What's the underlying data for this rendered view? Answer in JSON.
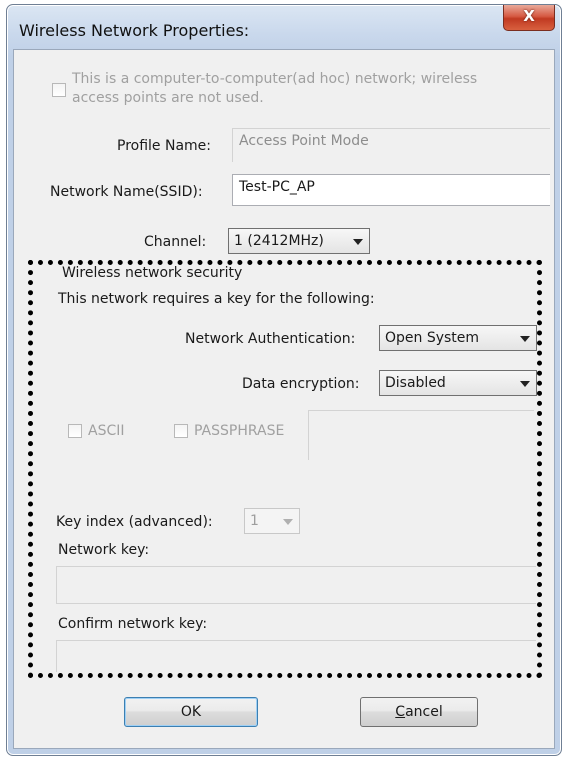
{
  "window": {
    "title": "Wireless Network Properties:",
    "close_glyph": "X"
  },
  "adhoc": {
    "label_line1": "This is a computer-to-computer(ad hoc) network; wireless",
    "label_line2": "access points are not used.",
    "checked": false
  },
  "profile": {
    "label": "Profile Name:",
    "value": "Access Point Mode"
  },
  "ssid": {
    "label": "Network Name(SSID):",
    "value": "Test-PC_AP"
  },
  "channel": {
    "label": "Channel:",
    "value": "1  (2412MHz)"
  },
  "security": {
    "group_title": "Wireless network security",
    "requires_text": "This network requires a key for the following:",
    "auth_label": "Network Authentication:",
    "auth_value": "Open System",
    "enc_label": "Data encryption:",
    "enc_value": "Disabled",
    "ascii_label": "ASCII",
    "passphrase_label": "PASSPHRASE",
    "key_index_label": "Key index (advanced):",
    "key_index_value": "1",
    "network_key_label": "Network key:",
    "confirm_key_label": "Confirm network key:"
  },
  "buttons": {
    "ok": "OK",
    "cancel_first": "C",
    "cancel_rest": "ancel"
  }
}
